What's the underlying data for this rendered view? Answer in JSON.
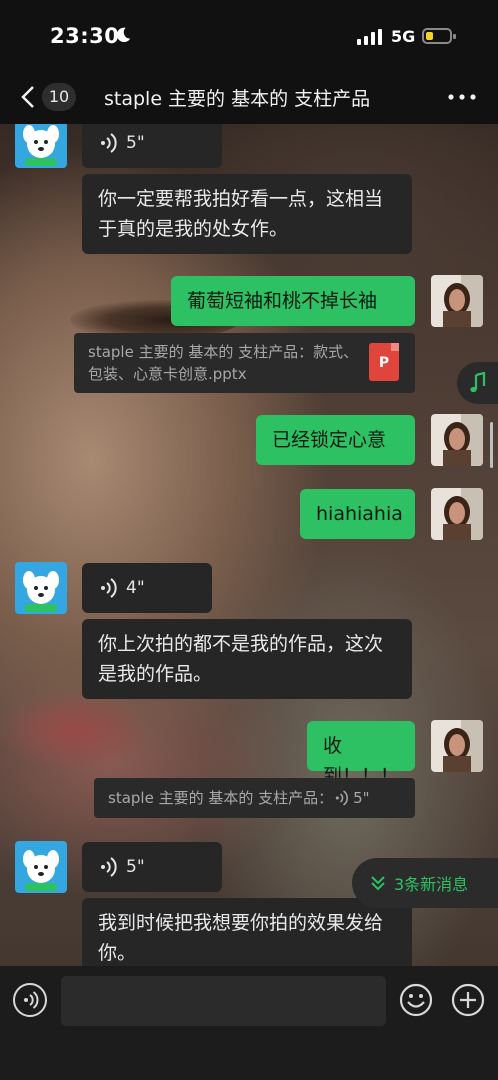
{
  "status_bar": {
    "time": "23:30",
    "network": "5G",
    "battery_level": 0.3
  },
  "header": {
    "unread_count": "10",
    "title": "staple 主要的 基本的 支柱产品"
  },
  "messages": {
    "m1_voice": "5\"",
    "m2_text": "你一定要帮我拍好看一点，这相当于真的是我的处女作。",
    "m3_text": "葡萄短袖和桃不掉长袖",
    "m4_file": "staple 主要的 基本的 支柱产品：款式、包装、心意卡创意.pptx",
    "m4_file_icon": "P",
    "m5_text": "已经锁定心意",
    "m6_text": "hiahiahia",
    "m7_voice": "4\"",
    "m8_text": "你上次拍的都不是我的作品，这次是我的作品。",
    "m9_text": "收到！！！",
    "m9_quote": "staple 主要的 基本的 支柱产品：",
    "m9_quote_voice": "5\"",
    "m10_voice": "5\"",
    "m11_text": "我到时候把我想要你拍的效果发给你。"
  },
  "new_messages": "3条新消息",
  "composer": {
    "input_value": ""
  },
  "colors": {
    "sent_bubble": "#2dc164",
    "received_bubble": "#262626",
    "accent": "#2dc164",
    "topbar": "#111111"
  },
  "icons": [
    "moon-icon",
    "signal-icon",
    "battery-icon",
    "back-chevron-icon",
    "more-icon",
    "voice-wave-icon",
    "file-icon",
    "music-note-icon",
    "double-chevron-down-icon",
    "voice-input-icon",
    "emoji-icon",
    "plus-icon"
  ]
}
